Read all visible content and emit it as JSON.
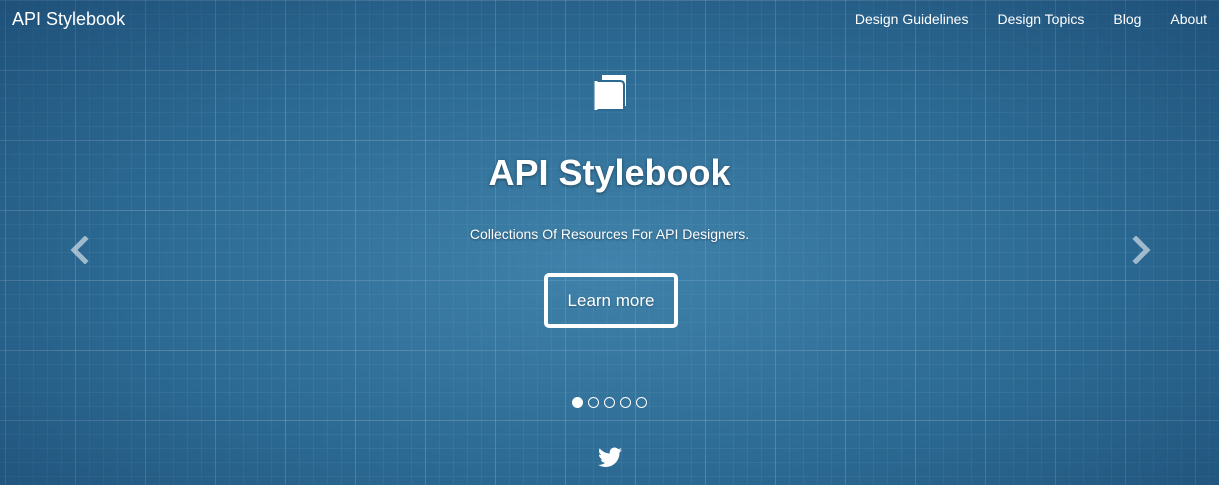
{
  "header": {
    "brand": "API Stylebook",
    "nav": [
      {
        "label": "Design Guidelines"
      },
      {
        "label": "Design Topics"
      },
      {
        "label": "Blog"
      },
      {
        "label": "About"
      }
    ]
  },
  "hero": {
    "icon": "book-icon",
    "title": "API Stylebook",
    "subtitle": "Collections Of Resources For API Designers.",
    "cta_label": "Learn more",
    "prev_icon": "chevron-left-icon",
    "next_icon": "chevron-right-icon",
    "slides_total": 5,
    "active_slide": 1
  },
  "footer": {
    "social_icon": "twitter-icon"
  },
  "colors": {
    "background": "#2c6a93",
    "text": "#ffffff"
  }
}
